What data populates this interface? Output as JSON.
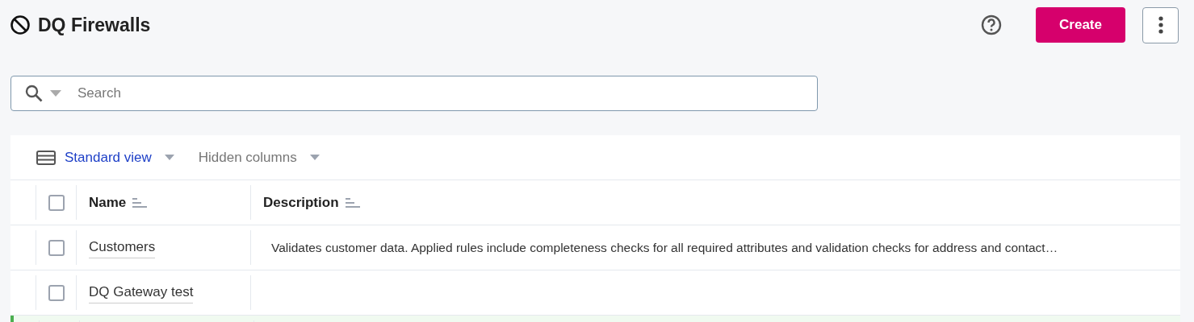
{
  "header": {
    "title": "DQ Firewalls",
    "create_button": "Create"
  },
  "search": {
    "placeholder": "Search"
  },
  "toolbar": {
    "view": "Standard view",
    "hidden_columns": "Hidden columns"
  },
  "table": {
    "columns": [
      {
        "label": "Name"
      },
      {
        "label": "Description"
      }
    ],
    "header_checked": false,
    "rows": [
      {
        "checked": false,
        "name": "Customers",
        "description": "Validates customer data. Applied rules include completeness checks for all required attributes and validation checks for address and contact…",
        "highlighted": false
      },
      {
        "checked": false,
        "name": "DQ Gateway test",
        "highlighted": false
      },
      {
        "highlighted": true
      }
    ]
  }
}
